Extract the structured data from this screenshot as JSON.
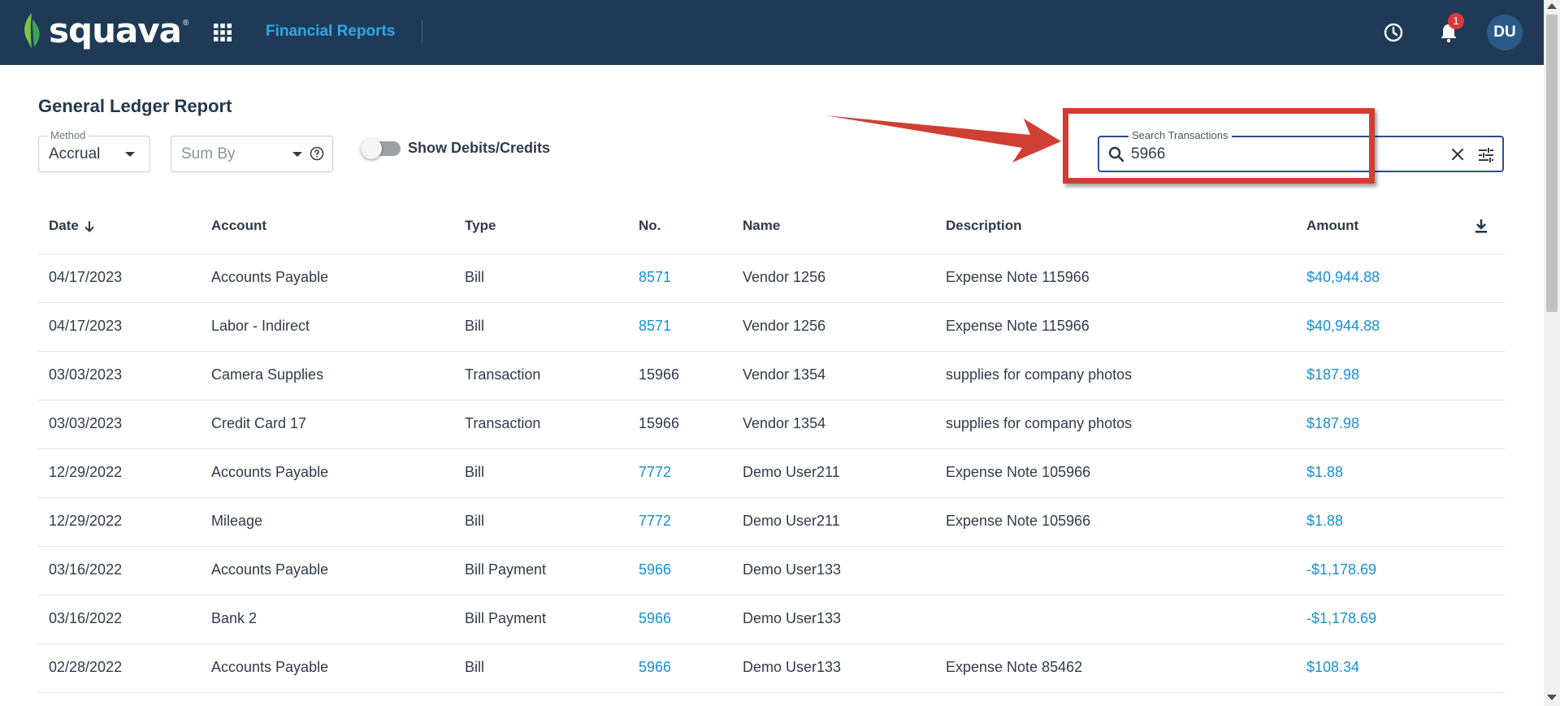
{
  "header": {
    "brand": "squava",
    "brand_mark": "®",
    "nav_title": "Financial Reports",
    "notification_count": "1",
    "avatar_initials": "DU",
    "icons": [
      "apps-grid-icon",
      "history-clock-icon",
      "bell-icon"
    ]
  },
  "page": {
    "title": "General Ledger Report"
  },
  "filters": {
    "method_label": "Method",
    "method_value": "Accrual",
    "sum_by_placeholder": "Sum By",
    "show_debits_credits_label": "Show Debits/Credits",
    "show_debits_credits_on": false
  },
  "search": {
    "label": "Search Transactions",
    "value": "5966"
  },
  "colors": {
    "header_bg": "#1f3a56",
    "accent_link": "#1a8fd0",
    "annotation_red": "#d03f33",
    "search_border": "#2c4c9a"
  },
  "table": {
    "columns": [
      "Date",
      "Account",
      "Type",
      "No.",
      "Name",
      "Description",
      "Amount"
    ],
    "rows": [
      {
        "date": "04/17/2023",
        "account": "Accounts Payable",
        "type": "Bill",
        "no": "8571",
        "no_link": true,
        "name": "Vendor 1256",
        "description": "Expense Note 115966",
        "amount": "$40,944.88"
      },
      {
        "date": "04/17/2023",
        "account": "Labor - Indirect",
        "type": "Bill",
        "no": "8571",
        "no_link": true,
        "name": "Vendor 1256",
        "description": "Expense Note 115966",
        "amount": "$40,944.88"
      },
      {
        "date": "03/03/2023",
        "account": "Camera Supplies",
        "type": "Transaction",
        "no": "15966",
        "no_link": false,
        "name": "Vendor 1354",
        "description": "supplies for company photos",
        "amount": "$187.98"
      },
      {
        "date": "03/03/2023",
        "account": "Credit Card 17",
        "type": "Transaction",
        "no": "15966",
        "no_link": false,
        "name": "Vendor 1354",
        "description": "supplies for company photos",
        "amount": "$187.98"
      },
      {
        "date": "12/29/2022",
        "account": "Accounts Payable",
        "type": "Bill",
        "no": "7772",
        "no_link": true,
        "name": "Demo User211",
        "description": "Expense Note 105966",
        "amount": "$1.88"
      },
      {
        "date": "12/29/2022",
        "account": "Mileage",
        "type": "Bill",
        "no": "7772",
        "no_link": true,
        "name": "Demo User211",
        "description": "Expense Note 105966",
        "amount": "$1.88"
      },
      {
        "date": "03/16/2022",
        "account": "Accounts Payable",
        "type": "Bill Payment",
        "no": "5966",
        "no_link": true,
        "name": "Demo User133",
        "description": "",
        "amount": "-$1,178.69"
      },
      {
        "date": "03/16/2022",
        "account": "Bank 2",
        "type": "Bill Payment",
        "no": "5966",
        "no_link": true,
        "name": "Demo User133",
        "description": "",
        "amount": "-$1,178.69"
      },
      {
        "date": "02/28/2022",
        "account": "Accounts Payable",
        "type": "Bill",
        "no": "5966",
        "no_link": true,
        "name": "Demo User133",
        "description": "Expense Note 85462",
        "amount": "$108.34"
      }
    ]
  }
}
